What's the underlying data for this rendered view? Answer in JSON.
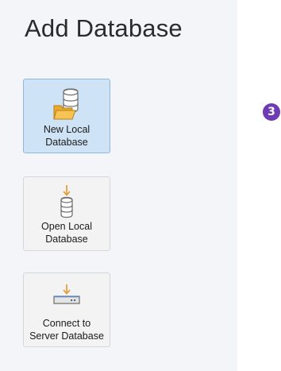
{
  "panel": {
    "title": "Add Database"
  },
  "tiles": [
    {
      "line1": "New Local",
      "line2": "Database",
      "state": "selected",
      "icon": "new-local-database-icon"
    },
    {
      "line1": "Open Local",
      "line2": "Database",
      "state": "normal",
      "icon": "open-local-database-icon"
    },
    {
      "line1": "Connect to",
      "line2": "Server Database",
      "state": "normal",
      "icon": "connect-server-database-icon"
    }
  ],
  "badge": {
    "number": "3"
  },
  "colors": {
    "selected_tile": "#cfe3f6",
    "selected_border": "#8fb8e0",
    "normal_tile": "#f3f3f3",
    "panel_bg": "#f4f5f8",
    "folder": "#f0b840",
    "arrow": "#e8962a",
    "badge": "#6f3bb5"
  }
}
